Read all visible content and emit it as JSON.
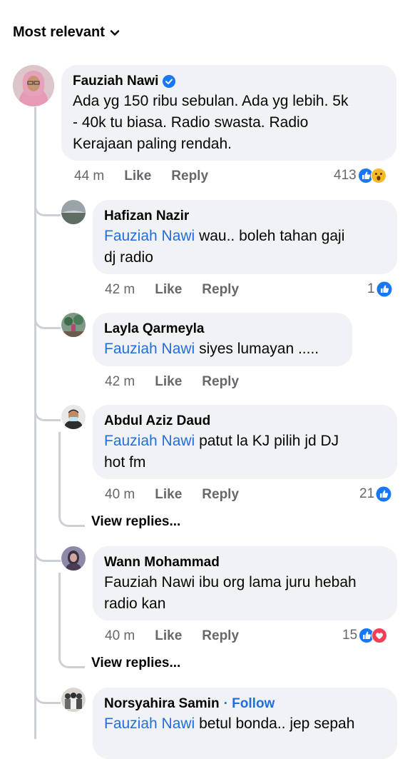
{
  "sort": {
    "label": "Most relevant"
  },
  "comments": [
    {
      "name": "Fauziah Nawi",
      "text": "Ada yg 150 ribu sebulan. Ada yg lebih. 5k - 40k tu biasa. Radio swasta. Radio Kerajaan paling rendah.",
      "text_lines": [
        "Ada yg 150 ribu sebulan. Ada yg lebih. 5k",
        "- 40k tu biasa. Radio swasta. Radio",
        "Kerajaan paling rendah."
      ],
      "time": "44 m",
      "like": "Like",
      "reply": "Reply",
      "reactions": "413"
    }
  ],
  "replies": [
    {
      "name": "Hafizan Nazir",
      "mention": "Fauziah Nawi",
      "text_line1": " wau.. boleh tahan gaji",
      "text_line2": "dj radio",
      "time": "42 m",
      "like": "Like",
      "reply": "Reply",
      "reactions": "1"
    },
    {
      "name": "Layla Qarmeyla",
      "mention": "Fauziah Nawi",
      "text_line1": " siyes lumayan .....",
      "time": "42 m",
      "like": "Like",
      "reply": "Reply"
    },
    {
      "name": "Abdul Aziz Daud",
      "mention": "Fauziah Nawi",
      "text_line1": " patut la KJ pilih jd DJ",
      "text_line2": "hot fm",
      "time": "40 m",
      "like": "Like",
      "reply": "Reply",
      "reactions": "21",
      "view_replies": "View replies..."
    },
    {
      "name": "Wann Mohammad",
      "text_line1": "Fauziah Nawi ibu org lama juru hebah",
      "text_line2": "radio kan",
      "time": "40 m",
      "like": "Like",
      "reply": "Reply",
      "reactions": "15",
      "view_replies": "View replies..."
    },
    {
      "name": "Norsyahira Samin",
      "follow": "· Follow",
      "mention": "Fauziah Nawi",
      "text_line1": " betul bonda.. jep sepah"
    }
  ],
  "colors": {
    "like_blue": "#1877f2",
    "mention_blue": "#216fdb",
    "love_red": "#f33e58",
    "wow_yellow": "#f7b928",
    "bubble": "#f0f2f5"
  },
  "icons": [
    "chevron-down-icon",
    "verified-badge-icon",
    "like-reaction-icon",
    "wow-reaction-icon",
    "love-reaction-icon"
  ]
}
